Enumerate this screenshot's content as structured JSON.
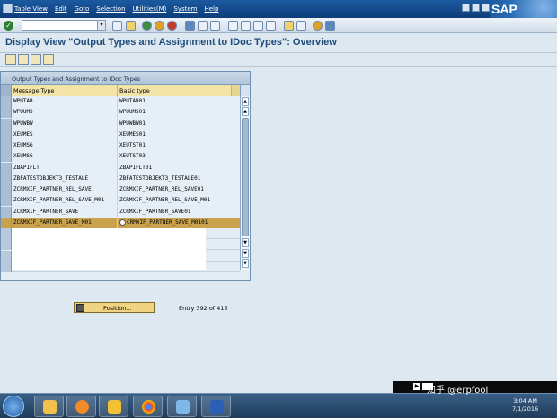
{
  "menu": {
    "items": [
      "Table View",
      "Edit",
      "Goto",
      "Selection",
      "Utilities(M)",
      "System",
      "Help"
    ],
    "logo": "SAP"
  },
  "title": "Display View \"Output Types and Assignment to IDoc Types\": Overview",
  "table": {
    "title": "Output Types and Assignment to IDoc Types",
    "columns": [
      "Message Type",
      "Basic type"
    ],
    "rows": [
      [
        "WPUTAB",
        "WPUTAB01"
      ],
      [
        "WPUUMS",
        "WPUUMS01"
      ],
      [
        "WPUWBW",
        "WPUWBW01"
      ],
      [
        "XEUMES",
        "XEUMES01"
      ],
      [
        "XEUMSG",
        "XEUTST01"
      ],
      [
        "XEUMSG",
        "XEUTST03"
      ],
      [
        "ZBAPIFLT",
        "ZBAPIFLT01"
      ],
      [
        "ZBFATESTOBJEKT3_TESTALE",
        "ZBFATESTOBJEKT3_TESTALE01"
      ],
      [
        "ZCRMXIF_PARTNER_REL_SAVE",
        "ZCRMXIF_PARTNER_REL_SAVE01"
      ],
      [
        "ZCRMXIF_PARTNER_REL_SAVE_M01",
        "ZCRMXIF_PARTNER_REL_SAVE_M01"
      ],
      [
        "ZCRMXIF_PARTNER_SAVE",
        "ZCRMXIF_PARTNER_SAVE01"
      ],
      [
        "ZCRMXIF_PARTNER_SAVE_M01",
        "CRMXIF_PARTNER_SAVE_M0101"
      ]
    ],
    "active_row": 11
  },
  "position_button": "Position...",
  "entry_text": "Entry 392 of 415",
  "taskbar": {
    "watermark": "知乎 @erpfool",
    "time": "3:04 AM",
    "date": "7/1/2016"
  },
  "colors": {
    "menubar": "#1b5aa0",
    "title_text": "#1e4b7a",
    "header": "#f3e3a6",
    "active_row": "#c9a24e"
  }
}
